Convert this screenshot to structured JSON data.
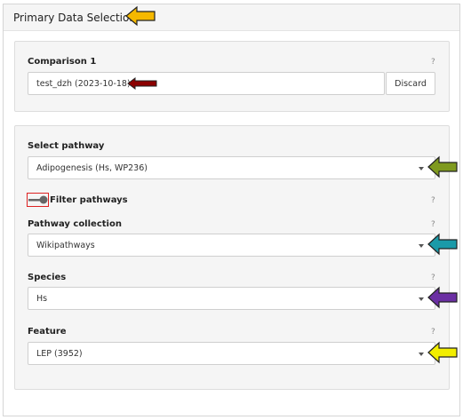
{
  "panel": {
    "title": "Primary Data Selection"
  },
  "comparison": {
    "label": "Comparison 1",
    "help": "?",
    "value": "test_dzh (2023-10-18)",
    "discard_label": "Discard"
  },
  "pathway": {
    "label": "Select pathway",
    "value": "Adipogenesis (Hs, WP236)"
  },
  "filter": {
    "label": "Filter pathways",
    "help": "?"
  },
  "collection": {
    "label": "Pathway collection",
    "help": "?",
    "value": "Wikipathways"
  },
  "species": {
    "label": "Species",
    "help": "?",
    "value": "Hs"
  },
  "feature": {
    "label": "Feature",
    "help": "?",
    "value": "LEP (3952)"
  },
  "colors": {
    "arrow_title": "#f5b800",
    "arrow_comparison": "#8b0000",
    "arrow_pathway": "#7f9a1f",
    "arrow_collection": "#1a9aa8",
    "arrow_species": "#6b2fa3",
    "arrow_feature": "#f2ee00"
  }
}
